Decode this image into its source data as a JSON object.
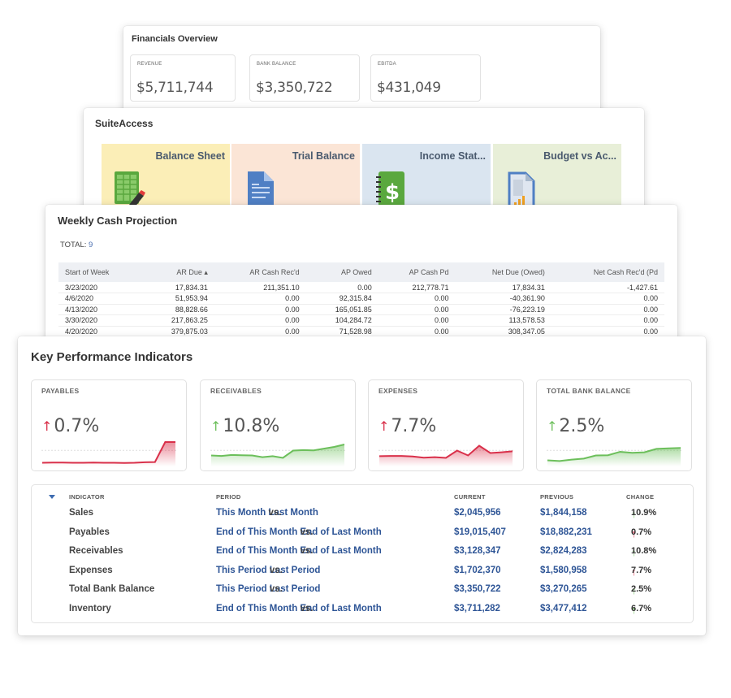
{
  "financials_overview": {
    "title": "Financials Overview",
    "cards": [
      {
        "label": "REVENUE",
        "value": "$5,711,744"
      },
      {
        "label": "BANK BALANCE",
        "value": "$3,350,722"
      },
      {
        "label": "EBITDA",
        "value": "$431,049"
      }
    ]
  },
  "suite_access": {
    "title": "SuiteAccess",
    "tiles": [
      {
        "label": "Balance Sheet",
        "icon": "spreadsheet-pencil-icon",
        "bg": "#fbeeb7"
      },
      {
        "label": "Trial Balance",
        "icon": "document-icon",
        "bg": "#fbe5d6"
      },
      {
        "label": "Income Stat...",
        "icon": "dollar-notebook-icon",
        "bg": "#dae5f0"
      },
      {
        "label": "Budget vs Ac...",
        "icon": "chart-document-icon",
        "bg": "#e8efd8"
      }
    ]
  },
  "weekly_cash": {
    "title": "Weekly Cash Projection",
    "total_label": "TOTAL:",
    "total_value": "9",
    "columns": [
      "Start of Week",
      "AR Due ▴",
      "AR Cash Rec'd",
      "AP Owed",
      "AP Cash Pd",
      "Net Due (Owed)",
      "Net Cash Rec'd (Pd"
    ],
    "rows": [
      [
        "3/23/2020",
        "17,834.31",
        "211,351.10",
        "0.00",
        "212,778.71",
        "17,834.31",
        "-1,427.61"
      ],
      [
        "4/6/2020",
        "51,953.94",
        "0.00",
        "92,315.84",
        "0.00",
        "-40,361.90",
        "0.00"
      ],
      [
        "4/13/2020",
        "88,828.66",
        "0.00",
        "165,051.85",
        "0.00",
        "-76,223.19",
        "0.00"
      ],
      [
        "3/30/2020",
        "217,863.25",
        "0.00",
        "104,284.72",
        "0.00",
        "113,578.53",
        "0.00"
      ],
      [
        "4/20/2020",
        "379,875.03",
        "0.00",
        "71,528.98",
        "0.00",
        "308,347.05",
        "0.00"
      ]
    ]
  },
  "kpi": {
    "title": "Key Performance Indicators",
    "colors": {
      "up_bad": "#d9304a",
      "up_good": "#6cbf5b"
    },
    "cards": [
      {
        "label": "PAYABLES",
        "value": "0.7%",
        "trend": "up",
        "sentiment": "bad",
        "spark": [
          0.05,
          0.06,
          0.06,
          0.05,
          0.05,
          0.06,
          0.05,
          0.05,
          0.04,
          0.05,
          0.07,
          0.08,
          0.9,
          0.9
        ]
      },
      {
        "label": "RECEIVABLES",
        "value": "10.8%",
        "trend": "up",
        "sentiment": "good",
        "spark": [
          0.35,
          0.33,
          0.37,
          0.36,
          0.35,
          0.28,
          0.32,
          0.25,
          0.55,
          0.57,
          0.56,
          0.63,
          0.7,
          0.8
        ]
      },
      {
        "label": "EXPENSES",
        "value": "7.7%",
        "trend": "up",
        "sentiment": "bad",
        "spark": [
          0.32,
          0.33,
          0.33,
          0.31,
          0.26,
          0.28,
          0.25,
          0.55,
          0.35,
          0.75,
          0.45,
          0.48,
          0.52
        ]
      },
      {
        "label": "TOTAL BANK BALANCE",
        "value": "2.5%",
        "trend": "up",
        "sentiment": "good",
        "spark": [
          0.15,
          0.12,
          0.18,
          0.22,
          0.35,
          0.36,
          0.5,
          0.46,
          0.48,
          0.62,
          0.64,
          0.66
        ]
      }
    ],
    "table": {
      "headers": {
        "indicator": "INDICATOR",
        "period": "PERIOD",
        "current": "CURRENT",
        "previous": "PREVIOUS",
        "change": "CHANGE"
      },
      "rows": [
        {
          "indicator": "Sales",
          "p1": "This Month",
          "vs": "vs.",
          "p2": "Last Month",
          "current": "$2,045,956",
          "previous": "$1,844,158",
          "change": "10.9%",
          "sentiment": "good"
        },
        {
          "indicator": "Payables",
          "p1": "End of This Month",
          "vs": "vs.",
          "p2": "End of Last Month",
          "current": "$19,015,407",
          "previous": "$18,882,231",
          "change": "0.7%",
          "sentiment": "bad"
        },
        {
          "indicator": "Receivables",
          "p1": "End of This Month",
          "vs": "vs.",
          "p2": "End of Last Month",
          "current": "$3,128,347",
          "previous": "$2,824,283",
          "change": "10.8%",
          "sentiment": "good"
        },
        {
          "indicator": "Expenses",
          "p1": "This Period",
          "vs": "vs.",
          "p2": "Last Period",
          "current": "$1,702,370",
          "previous": "$1,580,958",
          "change": "7.7%",
          "sentiment": "bad"
        },
        {
          "indicator": "Total Bank Balance",
          "p1": "This Period",
          "vs": "vs.",
          "p2": "Last Period",
          "current": "$3,350,722",
          "previous": "$3,270,265",
          "change": "2.5%",
          "sentiment": "good"
        },
        {
          "indicator": "Inventory",
          "p1": "End of This Month",
          "vs": "vs.",
          "p2": "End of Last Month",
          "current": "$3,711,282",
          "previous": "$3,477,412",
          "change": "6.7%",
          "sentiment": "good"
        }
      ]
    }
  }
}
